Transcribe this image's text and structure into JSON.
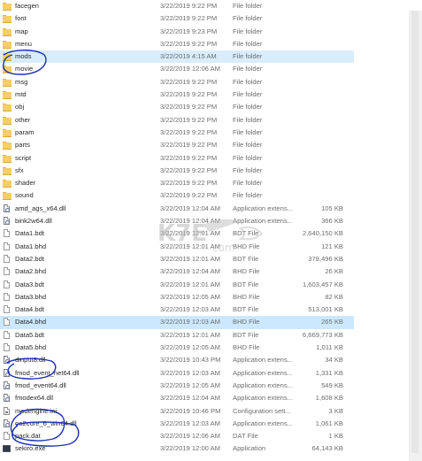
{
  "files": [
    {
      "name": "facegen",
      "date": "3/22/2019 9:22 PM",
      "type": "File folder",
      "size": "",
      "kind": "folder"
    },
    {
      "name": "font",
      "date": "3/22/2019 9:22 PM",
      "type": "File folder",
      "size": "",
      "kind": "folder"
    },
    {
      "name": "map",
      "date": "3/22/2019 9:23 PM",
      "type": "File folder",
      "size": "",
      "kind": "folder"
    },
    {
      "name": "menu",
      "date": "3/22/2019 9:22 PM",
      "type": "File folder",
      "size": "",
      "kind": "folder"
    },
    {
      "name": "mods",
      "date": "3/22/2019 4:15 AM",
      "type": "File folder",
      "size": "",
      "kind": "folder",
      "selected": true
    },
    {
      "name": "movie",
      "date": "3/22/2019 12:06 AM",
      "type": "File folder",
      "size": "",
      "kind": "folder"
    },
    {
      "name": "msg",
      "date": "3/22/2019 9:22 PM",
      "type": "File folder",
      "size": "",
      "kind": "folder"
    },
    {
      "name": "mtd",
      "date": "3/22/2019 9:22 PM",
      "type": "File folder",
      "size": "",
      "kind": "folder"
    },
    {
      "name": "obj",
      "date": "3/22/2019 9:22 PM",
      "type": "File folder",
      "size": "",
      "kind": "folder"
    },
    {
      "name": "other",
      "date": "3/22/2019 9:22 PM",
      "type": "File folder",
      "size": "",
      "kind": "folder"
    },
    {
      "name": "param",
      "date": "3/22/2019 9:22 PM",
      "type": "File folder",
      "size": "",
      "kind": "folder"
    },
    {
      "name": "parts",
      "date": "3/22/2019 9:22 PM",
      "type": "File folder",
      "size": "",
      "kind": "folder"
    },
    {
      "name": "script",
      "date": "3/22/2019 9:22 PM",
      "type": "File folder",
      "size": "",
      "kind": "folder"
    },
    {
      "name": "sfx",
      "date": "3/22/2019 9:22 PM",
      "type": "File folder",
      "size": "",
      "kind": "folder"
    },
    {
      "name": "shader",
      "date": "3/22/2019 9:22 PM",
      "type": "File folder",
      "size": "",
      "kind": "folder"
    },
    {
      "name": "sound",
      "date": "3/22/2019 9:22 PM",
      "type": "File folder",
      "size": "",
      "kind": "folder"
    },
    {
      "name": "amd_ags_x64.dll",
      "date": "3/22/2019 12:04 AM",
      "type": "Application extens...",
      "size": "105 KB",
      "kind": "dll"
    },
    {
      "name": "bink2w64.dll",
      "date": "3/22/2019 12:04 AM",
      "type": "Application extens...",
      "size": "366 KB",
      "kind": "dll"
    },
    {
      "name": "Data1.bdt",
      "date": "3/22/2019 12:01 AM",
      "type": "BDT File",
      "size": "2,640,150 KB",
      "kind": "file"
    },
    {
      "name": "Data1.bhd",
      "date": "3/22/2019 12:01 AM",
      "type": "BHD File",
      "size": "121 KB",
      "kind": "file"
    },
    {
      "name": "Data2.bdt",
      "date": "3/22/2019 12:01 AM",
      "type": "BDT File",
      "size": "378,496 KB",
      "kind": "file"
    },
    {
      "name": "Data2.bhd",
      "date": "3/22/2019 12:04 AM",
      "type": "BHD File",
      "size": "26 KB",
      "kind": "file"
    },
    {
      "name": "Data3.bdt",
      "date": "3/22/2019 12:01 AM",
      "type": "BDT File",
      "size": "1,603,457 KB",
      "kind": "file"
    },
    {
      "name": "Data3.bhd",
      "date": "3/22/2019 12:05 AM",
      "type": "BHD File",
      "size": "82 KB",
      "kind": "file"
    },
    {
      "name": "Data4.bdt",
      "date": "3/22/2019 12:03 AM",
      "type": "BDT File",
      "size": "513,001 KB",
      "kind": "file"
    },
    {
      "name": "Data4.bhd",
      "date": "3/22/2019 12:03 AM",
      "type": "BHD File",
      "size": "265 KB",
      "kind": "file",
      "selected": true
    },
    {
      "name": "Data5.bdt",
      "date": "3/22/2019 12:01 AM",
      "type": "BDT File",
      "size": "6,669,773 KB",
      "kind": "file"
    },
    {
      "name": "Data5.bhd",
      "date": "3/22/2019 12:05 AM",
      "type": "BHD File",
      "size": "1,011 KB",
      "kind": "file"
    },
    {
      "name": "dinput8.dll",
      "date": "3/22/2019 10:43 PM",
      "type": "Application extens...",
      "size": "34 KB",
      "kind": "dll"
    },
    {
      "name": "fmod_event_net64.dll",
      "date": "3/22/2019 12:03 AM",
      "type": "Application extens...",
      "size": "1,331 KB",
      "kind": "dll"
    },
    {
      "name": "fmod_event64.dll",
      "date": "3/22/2019 12:05 AM",
      "type": "Application extens...",
      "size": "549 KB",
      "kind": "dll"
    },
    {
      "name": "fmodex64.dll",
      "date": "3/22/2019 12:04 AM",
      "type": "Application extens...",
      "size": "1,608 KB",
      "kind": "dll"
    },
    {
      "name": "modengine.ini",
      "date": "3/22/2019 10:46 PM",
      "type": "Configuration sett...",
      "size": "3 KB",
      "kind": "ini"
    },
    {
      "name": "oo2core_6_win64.dll",
      "date": "3/22/2019 12:03 AM",
      "type": "Application extens...",
      "size": "1,061 KB",
      "kind": "dll"
    },
    {
      "name": "pack.dat",
      "date": "3/22/2019 12:06 AM",
      "type": "DAT File",
      "size": "1 KB",
      "kind": "file"
    },
    {
      "name": "sekiro.exe",
      "date": "3/22/2019 12:00 AM",
      "type": "Application",
      "size": "64,143 KB",
      "kind": "exe"
    }
  ],
  "watermark": {
    "text": "K7E",
    "subtext": "com"
  },
  "colors": {
    "selected_row": "#cce8ff",
    "annotation_ink": "#1a2fb8",
    "folder": "#f6cf5e"
  }
}
